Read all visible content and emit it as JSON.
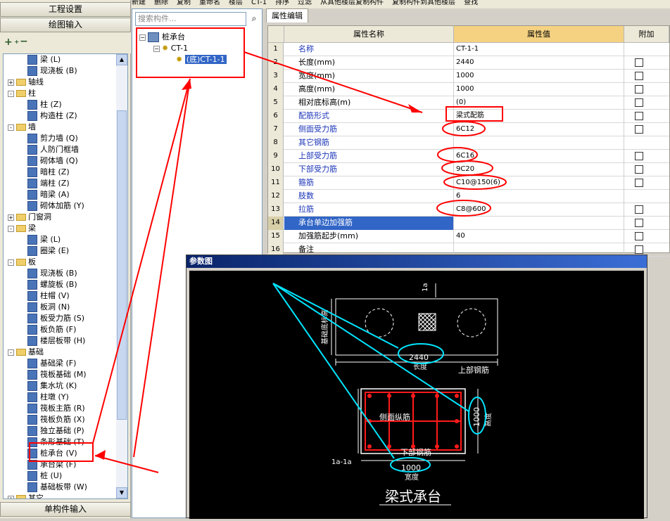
{
  "left_panel": {
    "top_buttons": [
      "工程设置",
      "绘图输入"
    ],
    "bottom_button": "单构件输入",
    "toolbar_icons": [
      "expand-all-icon",
      "collapse-all-icon"
    ],
    "tree": [
      {
        "level": 2,
        "label": "梁 (L)",
        "icon": "beam-icon"
      },
      {
        "level": 2,
        "label": "现浇板 (B)",
        "icon": "slab-icon"
      },
      {
        "level": 1,
        "label": "轴线",
        "expander": "+",
        "folder": true
      },
      {
        "level": 1,
        "label": "柱",
        "expander": "-",
        "folder": true
      },
      {
        "level": 2,
        "label": "柱 (Z)",
        "icon": "column-icon"
      },
      {
        "level": 2,
        "label": "构造柱 (Z)",
        "icon": "column-icon"
      },
      {
        "level": 1,
        "label": "墙",
        "expander": "-",
        "folder": true
      },
      {
        "level": 2,
        "label": "剪力墙 (Q)",
        "icon": "wall-icon"
      },
      {
        "level": 2,
        "label": "人防门框墙",
        "icon": "wall-icon"
      },
      {
        "level": 2,
        "label": "砌体墙 (Q)",
        "icon": "wall-icon"
      },
      {
        "level": 2,
        "label": "暗柱 (Z)",
        "icon": "column-icon"
      },
      {
        "level": 2,
        "label": "端柱 (Z)",
        "icon": "column-icon"
      },
      {
        "level": 2,
        "label": "暗梁 (A)",
        "icon": "beam-icon"
      },
      {
        "level": 2,
        "label": "砌体加筋 (Y)",
        "icon": "rebar-icon"
      },
      {
        "level": 1,
        "label": "门窗洞",
        "expander": "+",
        "folder": true
      },
      {
        "level": 1,
        "label": "梁",
        "expander": "-",
        "folder": true
      },
      {
        "level": 2,
        "label": "梁 (L)",
        "icon": "beam-icon"
      },
      {
        "level": 2,
        "label": "圈梁 (E)",
        "icon": "beam-icon"
      },
      {
        "level": 1,
        "label": "板",
        "expander": "-",
        "folder": true
      },
      {
        "level": 2,
        "label": "现浇板 (B)",
        "icon": "slab-icon"
      },
      {
        "level": 2,
        "label": "螺旋板 (B)",
        "icon": "spiral-icon"
      },
      {
        "level": 2,
        "label": "柱帽 (V)",
        "icon": "column-cap-icon"
      },
      {
        "level": 2,
        "label": "板洞 (N)",
        "icon": "slab-hole-icon"
      },
      {
        "level": 2,
        "label": "板受力筋 (S)",
        "icon": "grid-icon"
      },
      {
        "level": 2,
        "label": "板负筋 (F)",
        "icon": "grid-icon"
      },
      {
        "level": 2,
        "label": "楼层板带 (H)",
        "icon": "strip-icon"
      },
      {
        "level": 1,
        "label": "基础",
        "expander": "-",
        "folder": true
      },
      {
        "level": 2,
        "label": "基础梁 (F)",
        "icon": "beam-icon"
      },
      {
        "level": 2,
        "label": "筏板基础 (M)",
        "icon": "slab-icon"
      },
      {
        "level": 2,
        "label": "集水坑 (K)",
        "icon": "pit-icon"
      },
      {
        "level": 2,
        "label": "柱墩 (Y)",
        "icon": "column-icon"
      },
      {
        "level": 2,
        "label": "筏板主筋 (R)",
        "icon": "grid-icon"
      },
      {
        "level": 2,
        "label": "筏板负筋 (X)",
        "icon": "grid-icon"
      },
      {
        "level": 2,
        "label": "独立基础 (P)",
        "icon": "footing-icon"
      },
      {
        "level": 2,
        "label": "条形基础 (T)",
        "icon": "footing-icon"
      },
      {
        "level": 2,
        "label": "桩承台 (V)",
        "icon": "pile-cap-icon",
        "highlight": true
      },
      {
        "level": 2,
        "label": "承台梁 (F)",
        "icon": "beam-icon"
      },
      {
        "level": 2,
        "label": "桩 (U)",
        "icon": "pile-icon"
      },
      {
        "level": 2,
        "label": "基础板带 (W)",
        "icon": "strip-icon"
      },
      {
        "level": 1,
        "label": "其它",
        "expander": "+",
        "folder": true
      }
    ]
  },
  "top_toolbar": {
    "items": [
      "新建",
      "删除",
      "复制",
      "重命名",
      "楼层",
      "CT-1",
      "排序",
      "过滤",
      "从其他楼层复制构件",
      "复制构件到其他楼层",
      "查找"
    ]
  },
  "component_tree": {
    "search_placeholder": "搜索构件...",
    "root": "桩承台",
    "child": "CT-1",
    "grandchild": "(底)CT-1-1"
  },
  "property_editor": {
    "tab": "属性编辑",
    "headers": {
      "name": "属性名称",
      "value": "属性值",
      "extra": "附加"
    },
    "rows": [
      {
        "n": "1",
        "name": "名称",
        "value": "CT-1-1",
        "blue": true,
        "check": false
      },
      {
        "n": "2",
        "name": "长度(mm)",
        "value": "2440",
        "blue": false,
        "check": true
      },
      {
        "n": "3",
        "name": "宽度(mm)",
        "value": "1000",
        "blue": false,
        "check": true
      },
      {
        "n": "4",
        "name": "高度(mm)",
        "value": "1000",
        "blue": false,
        "check": true
      },
      {
        "n": "5",
        "name": "相对底标高(m)",
        "value": "(0)",
        "blue": false,
        "check": true
      },
      {
        "n": "6",
        "name": "配筋形式",
        "value": "梁式配筋",
        "blue": true,
        "check": true
      },
      {
        "n": "7",
        "name": "侧面受力筋",
        "value": "6C12",
        "blue": true,
        "check": true
      },
      {
        "n": "8",
        "name": "其它钢筋",
        "value": "",
        "blue": true,
        "check": false
      },
      {
        "n": "9",
        "name": "上部受力筋",
        "value": "6C16",
        "blue": true,
        "check": true
      },
      {
        "n": "10",
        "name": "下部受力筋",
        "value": "9C20",
        "blue": true,
        "check": true
      },
      {
        "n": "11",
        "name": "箍筋",
        "value": "C10@150(6)",
        "blue": true,
        "check": true
      },
      {
        "n": "12",
        "name": "肢数",
        "value": "6",
        "blue": true,
        "check": false
      },
      {
        "n": "13",
        "name": "拉筋",
        "value": "C8@600",
        "blue": true,
        "check": true
      },
      {
        "n": "14",
        "name": "承台单边加强筋",
        "value": "",
        "blue": false,
        "check": true,
        "selected": true
      },
      {
        "n": "15",
        "name": "加强筋起步(mm)",
        "value": "40",
        "blue": false,
        "check": true
      },
      {
        "n": "16",
        "name": "备注",
        "value": "",
        "blue": false,
        "check": true
      }
    ]
  },
  "param_dialog": {
    "title": "参数图",
    "section_mark": "1a",
    "section_label": "1a-1a",
    "length_value": "2440",
    "length_label": "长度",
    "height_value": "1000",
    "height_label": "高度",
    "width_value": "1000",
    "width_label": "宽度",
    "top_rebar": "上部钢筋",
    "side_rebar": "侧面纵筋",
    "bottom_rebar": "下部钢筋",
    "elev_label": "基础底标高",
    "caption": "梁式承台"
  },
  "colors": {
    "annotation_red": "#ff0000",
    "annotation_cyan": "#00e5ff",
    "rebar_red": "#ff1a1a",
    "selection_blue": "#3165c6",
    "prop_blue": "#1b34b8"
  }
}
